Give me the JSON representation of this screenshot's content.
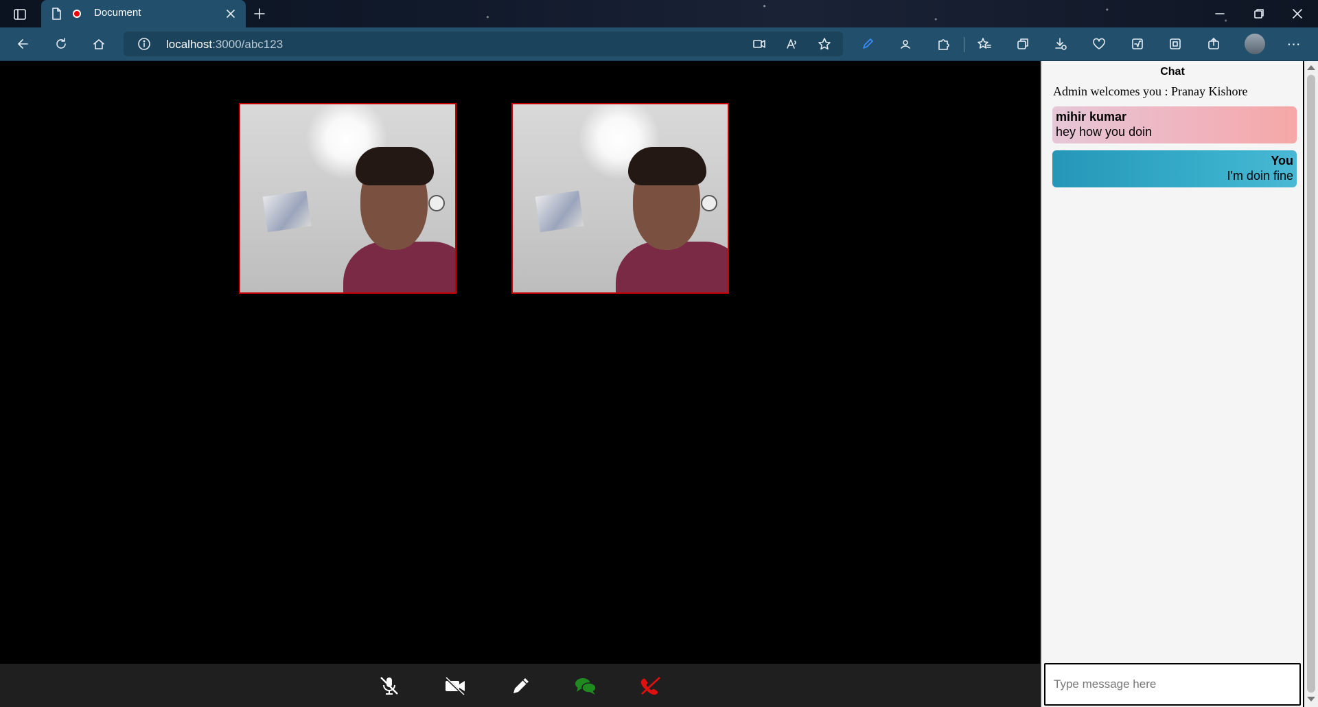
{
  "browser": {
    "tab_title": "Document",
    "url_host": "localhost",
    "url_path": ":3000/abc123"
  },
  "meeting": {
    "tiles": [
      {
        "label": "participant-video-1"
      },
      {
        "label": "participant-video-2"
      }
    ]
  },
  "controls": {
    "mute_icon": "mic-off-icon",
    "video_icon": "video-off-icon",
    "whiteboard_icon": "pencil-icon",
    "chat_icon": "chat-bubbles-icon",
    "leave_icon": "phone-off-icon",
    "chat_color": "#1f8a1f",
    "leave_color": "#e01010"
  },
  "chat": {
    "title": "Chat",
    "welcome": "Admin welcomes you : Pranay Kishore",
    "messages": [
      {
        "sender": "mihir kumar",
        "text": "hey how you doin"
      },
      {
        "sender": "You",
        "text": "I'm doin fine"
      }
    ],
    "input_placeholder": "Type message here"
  }
}
